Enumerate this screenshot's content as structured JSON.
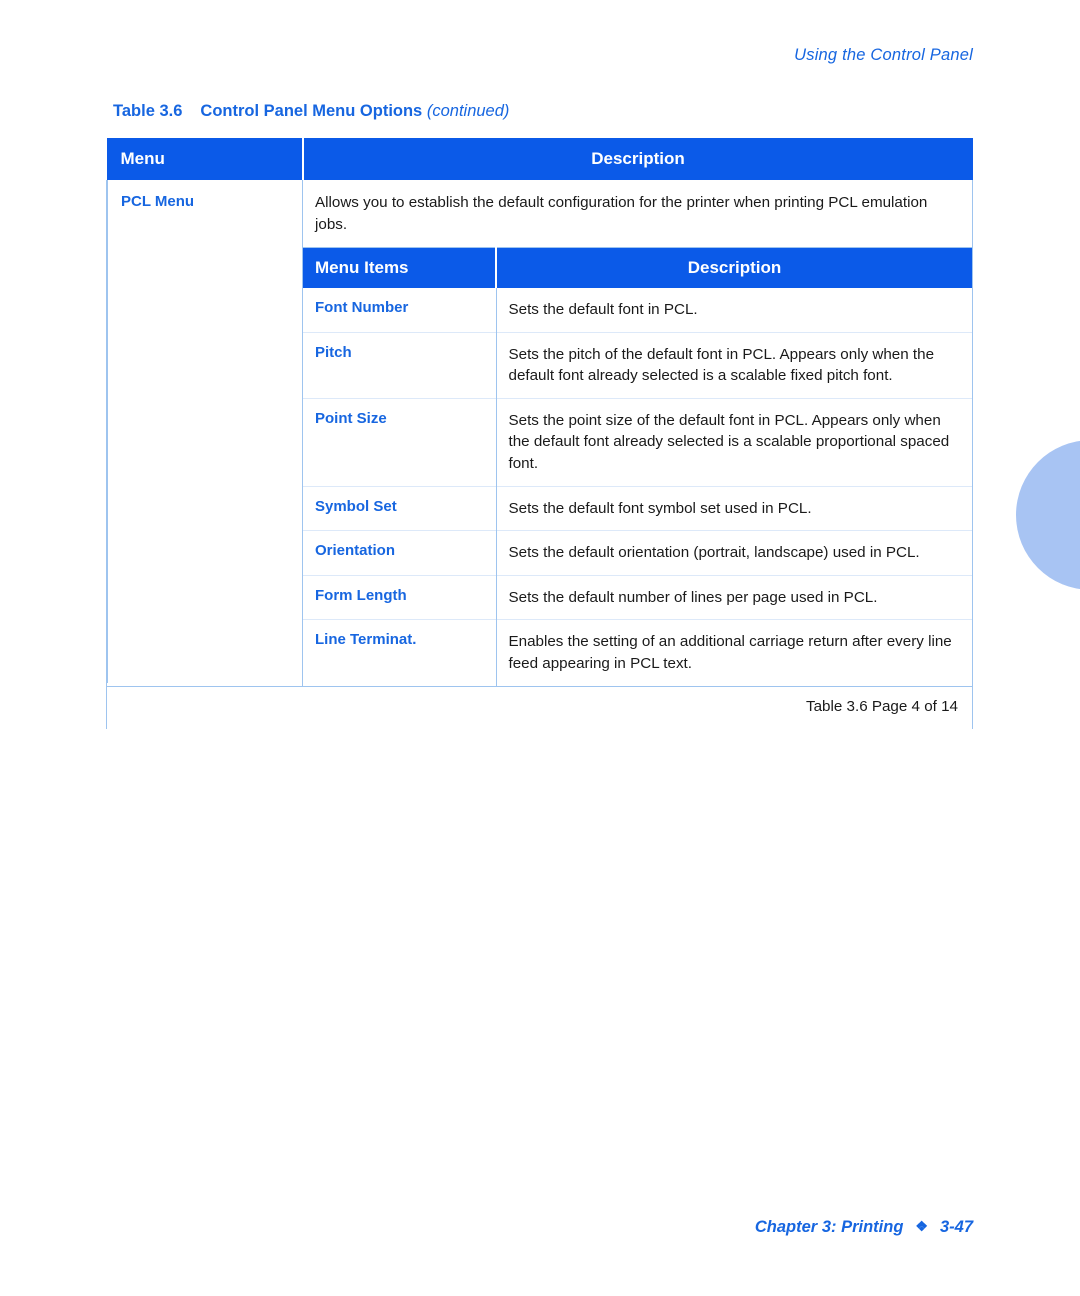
{
  "running_header": "Using the Control Panel",
  "table_caption": {
    "number": "Table 3.6",
    "title": "Control Panel Menu Options",
    "continued": "(continued)"
  },
  "colors": {
    "header_blue": "#0b5ae8",
    "link_blue": "#1766e0",
    "rule_blue": "#9ec4ef",
    "circle_blue": "#a8c4f3"
  },
  "table": {
    "headers": {
      "menu": "Menu",
      "description": "Description"
    },
    "menu_name": "PCL Menu",
    "menu_description": "Allows you to establish the default configuration for the printer when printing PCL emulation jobs.",
    "sub_headers": {
      "menu_items": "Menu Items",
      "description": "Description"
    },
    "items": [
      {
        "label": "Font Number",
        "description": "Sets the default font in PCL."
      },
      {
        "label": "Pitch",
        "description": "Sets the pitch of the default font in PCL. Appears only when the default font already selected is a scalable fixed pitch font."
      },
      {
        "label": "Point Size",
        "description": "Sets the point size of the default font in PCL. Appears only when the default font already selected is a scalable proportional spaced font."
      },
      {
        "label": "Symbol Set",
        "description": "Sets the default font symbol set used in PCL."
      },
      {
        "label": "Orientation",
        "description": "Sets the default orientation (portrait, landscape) used in PCL."
      },
      {
        "label": "Form Length",
        "description": "Sets the default number of lines per page used in PCL."
      },
      {
        "label": "Line Terminat.",
        "description": "Enables the setting of an additional carriage return after every line feed appearing in PCL text."
      }
    ],
    "footer_caption": "Table 3.6  Page 4 of 14"
  },
  "page_footer": {
    "chapter": "Chapter 3: Printing",
    "separator": "❖",
    "page_number": "3-47"
  }
}
